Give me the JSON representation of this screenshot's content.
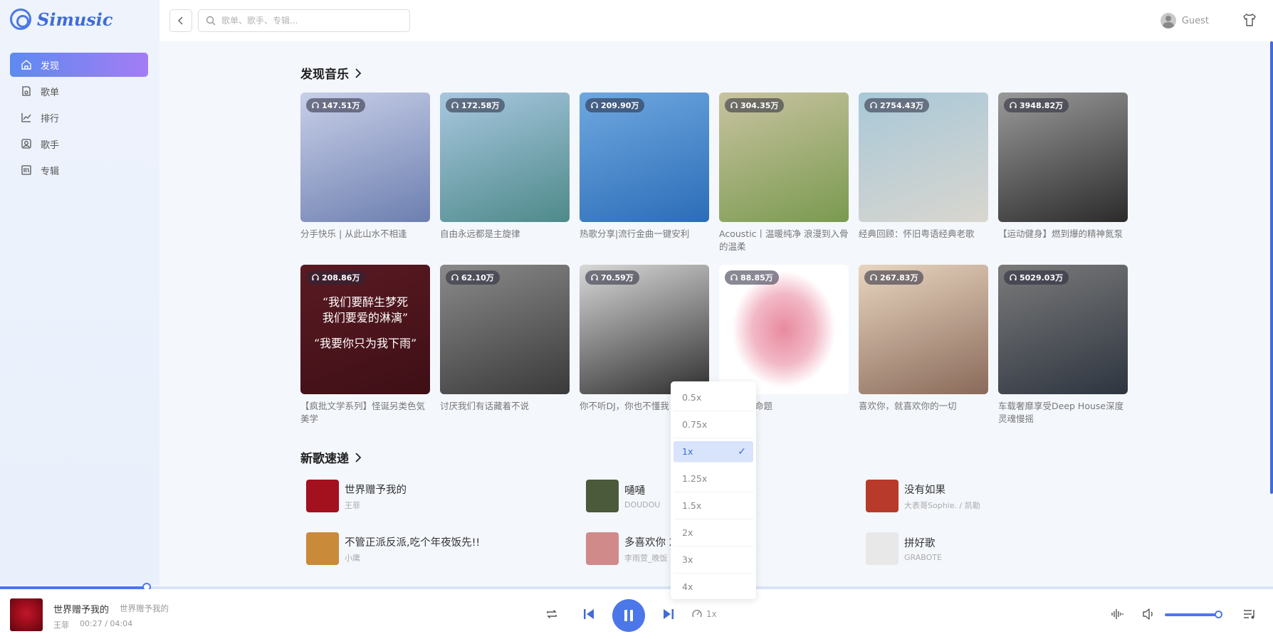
{
  "app": {
    "name": "Simusic"
  },
  "sidebar": {
    "items": [
      {
        "label": "发现",
        "icon": "home-icon",
        "active": true
      },
      {
        "label": "歌单",
        "icon": "playlist-icon",
        "active": false
      },
      {
        "label": "排行",
        "icon": "chart-icon",
        "active": false
      },
      {
        "label": "歌手",
        "icon": "singer-icon",
        "active": false
      },
      {
        "label": "专辑",
        "icon": "album-icon",
        "active": false
      }
    ]
  },
  "header": {
    "search_placeholder": "歌单、歌手、专辑...",
    "user_name": "Guest"
  },
  "discover": {
    "title": "发现音乐",
    "playlists": [
      {
        "count": "147.51万",
        "title": "分手快乐 | 从此山水不相逢",
        "colors": [
          "#c8cfe8",
          "#6d7fb0"
        ]
      },
      {
        "count": "172.58万",
        "title": "自由永远都是主旋律",
        "colors": [
          "#a8c7e0",
          "#4e8a8a"
        ]
      },
      {
        "count": "209.90万",
        "title": "热歌分享|流行金曲一键安利",
        "colors": [
          "#6fa8e0",
          "#2c6db8"
        ]
      },
      {
        "count": "304.35万",
        "title": "Acoustic丨温暖纯净 浪漫到入骨的温柔",
        "colors": [
          "#c9c3a0",
          "#7a9a50"
        ]
      },
      {
        "count": "2754.43万",
        "title": "经典回顾：怀旧粤语经典老歌",
        "colors": [
          "#a8c8d8",
          "#d9d6cf"
        ]
      },
      {
        "count": "3948.82万",
        "title": "【运动健身】燃到爆的精神氮泵",
        "colors": [
          "#9a9a9a",
          "#2b2b2b"
        ]
      },
      {
        "count": "208.86万",
        "title": "【疯批文学系列】怪诞另类色気美学",
        "colors": [
          "#5a1a22",
          "#3e0f16"
        ]
      },
      {
        "count": "62.10万",
        "title": "讨厌我们有话藏着不说",
        "colors": [
          "#8a8a8a",
          "#3a3a3a"
        ]
      },
      {
        "count": "70.59万",
        "title": "你不听DJ，你也不懂我",
        "colors": [
          "#d8d8d8",
          "#2f2f2f"
        ]
      },
      {
        "count": "88.85万",
        "title": "是无解的命题",
        "colors": [
          "#ffffff",
          "#e88a9e"
        ]
      },
      {
        "count": "267.83万",
        "title": "喜欢你，就喜欢你的一切",
        "colors": [
          "#e8d5c0",
          "#8a6a5a"
        ]
      },
      {
        "count": "5029.03万",
        "title": "车载奢靡享受Deep House深度灵魂慢摇",
        "colors": [
          "#7a7a7a",
          "#2e3540"
        ]
      }
    ],
    "quote_lines": [
      "“我们要醉生梦死",
      "我们要爱的淋漓”",
      "“我要你只为我下雨”"
    ]
  },
  "new_songs": {
    "title": "新歌速递",
    "songs": [
      {
        "name": "世界赠予我的",
        "artist": "王菲",
        "color": "#a3101e"
      },
      {
        "name": "嗵嗵",
        "artist": "DOUDOU",
        "color": "#4a5a3a"
      },
      {
        "name": "没有如果",
        "artist": "大表哥Sophie. / 凯勒",
        "color": "#b83a2a"
      },
      {
        "name": "不管正派反派,吃个年夜饭先!!",
        "artist": "小鹰",
        "color": "#c98a3a"
      },
      {
        "name": "多喜欢你 2",
        "artist": "李雨萱_晚饭",
        "color": "#d08a8a"
      },
      {
        "name": "拼好歌",
        "artist": "GRABOTE",
        "color": "#e8e8e8"
      }
    ]
  },
  "speed_menu": {
    "options": [
      "0.5x",
      "0.75x",
      "1x",
      "1.25x",
      "1.5x",
      "2x",
      "3x",
      "4x"
    ],
    "selected": "1x"
  },
  "player": {
    "title": "世界赠予我的",
    "subtitle": "世界赠予我的",
    "artist": "王菲",
    "time": "00:27 / 04:04",
    "progress": 0.115,
    "speed_label": "1x",
    "volume": 0.95
  }
}
